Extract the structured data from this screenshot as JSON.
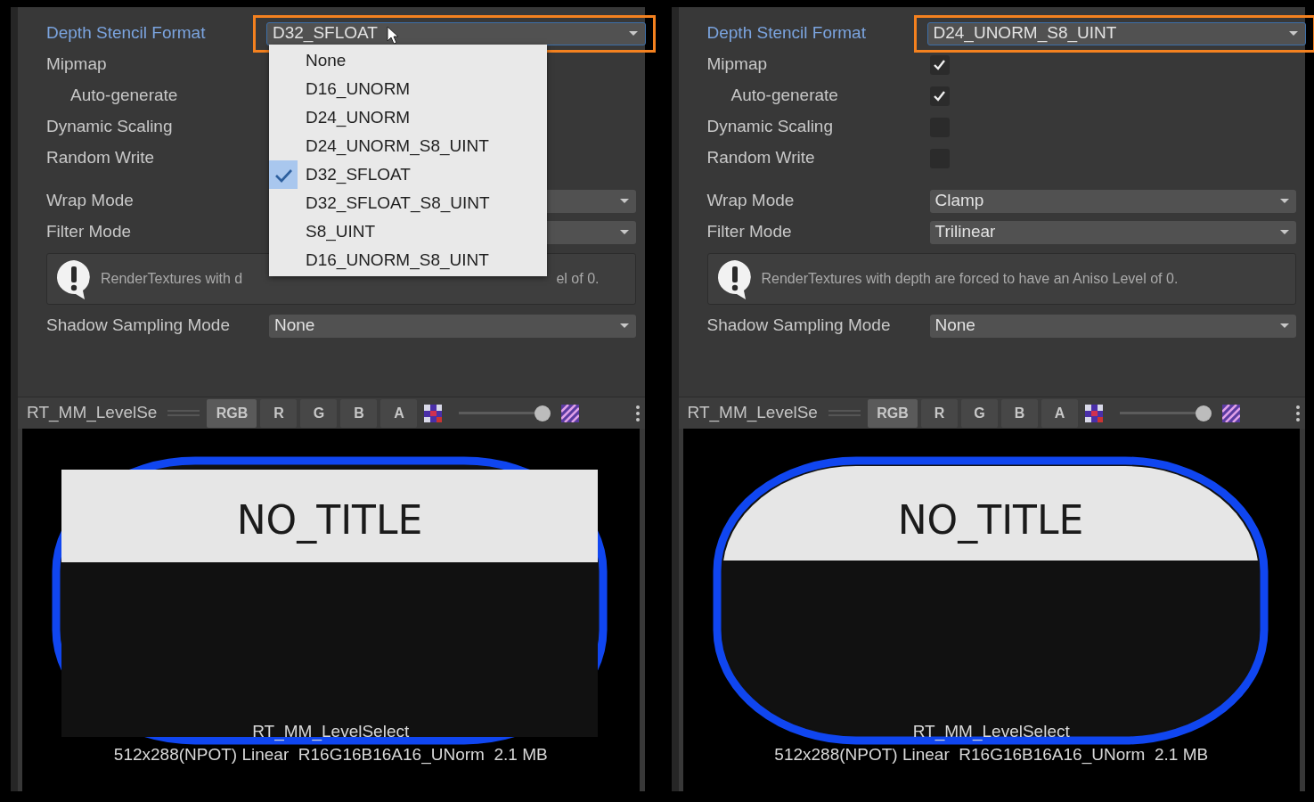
{
  "panels": [
    {
      "depth_stencil": {
        "label": "Depth Stencil Format",
        "value": "D32_SFLOAT",
        "focused": true,
        "pointer": true,
        "menu": [
          {
            "label": "None",
            "selected": false
          },
          {
            "label": "D16_UNORM",
            "selected": false
          },
          {
            "label": "D24_UNORM",
            "selected": false
          },
          {
            "label": "D24_UNORM_S8_UINT",
            "selected": false
          },
          {
            "label": "D32_SFLOAT",
            "selected": true
          },
          {
            "label": "D32_SFLOAT_S8_UINT",
            "selected": false
          },
          {
            "label": "S8_UINT",
            "selected": false
          },
          {
            "label": "D16_UNORM_S8_UINT",
            "selected": false
          }
        ]
      },
      "toggles": [
        {
          "label": "Mipmap",
          "children": [
            {
              "label": "Auto-generate"
            }
          ]
        },
        {
          "label": "Dynamic Scaling"
        },
        {
          "label": "Random Write"
        }
      ],
      "dropdowns": [
        {
          "label": "Wrap Mode"
        },
        {
          "label": "Filter Mode"
        }
      ],
      "message": {
        "texts": [
          "RenderTextures with d",
          "el of 0."
        ]
      },
      "shadow": {
        "label": "Shadow Sampling Mode",
        "value": "None"
      },
      "preview": {
        "title": "RT_MM_LevelSe",
        "channels": [
          {
            "label": "RGB",
            "selected": true
          },
          {
            "label": "R",
            "selected": false
          },
          {
            "label": "G",
            "selected": false
          },
          {
            "label": "B",
            "selected": false
          },
          {
            "label": "A",
            "selected": false
          }
        ],
        "level": 1,
        "kind": "square_band",
        "image_title": "NO_TITLE",
        "texture_name": "RT_MM_LevelSelect",
        "info": "512x288(NPOT) Linear  R16G16B16A16_UNorm  2.1 MB"
      }
    },
    {
      "depth_stencil": {
        "label": "Depth Stencil Format",
        "value": "D24_UNORM_S8_UINT",
        "focused": true
      },
      "toggles": [
        {
          "label": "Mipmap",
          "checked": true,
          "children": [
            {
              "label": "Auto-generate",
              "checked": true
            }
          ]
        },
        {
          "label": "Dynamic Scaling",
          "checked": false
        },
        {
          "label": "Random Write",
          "checked": false
        }
      ],
      "dropdowns": [
        {
          "label": "Wrap Mode",
          "value": "Clamp"
        },
        {
          "label": "Filter Mode",
          "value": "Trilinear"
        }
      ],
      "message": {
        "texts": [
          "RenderTextures with depth are forced to have an Aniso Level of 0."
        ]
      },
      "shadow": {
        "label": "Shadow Sampling Mode",
        "value": "None"
      },
      "preview": {
        "title": "RT_MM_LevelSe",
        "channels": [
          {
            "label": "RGB",
            "selected": true
          },
          {
            "label": "R",
            "selected": false
          },
          {
            "label": "G",
            "selected": false
          },
          {
            "label": "B",
            "selected": false
          },
          {
            "label": "A",
            "selected": false
          }
        ],
        "level": 1,
        "kind": "rounded_band",
        "image_title": "NO_TITLE",
        "texture_name": "RT_MM_LevelSelect",
        "info": "512x288(NPOT) Linear  R16G16B16A16_UNorm  2.1 MB"
      }
    }
  ]
}
